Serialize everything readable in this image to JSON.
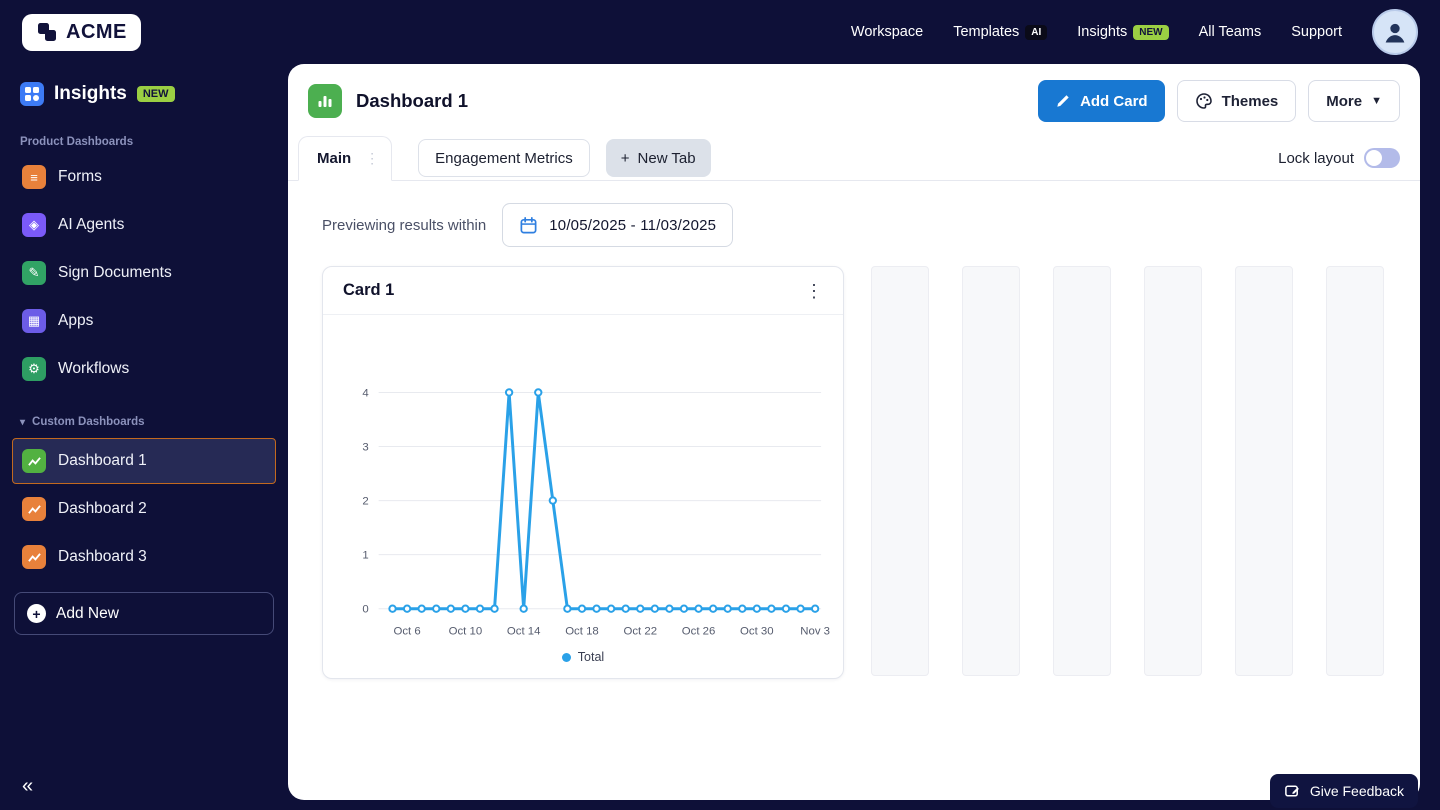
{
  "brand": {
    "name": "ACME"
  },
  "topnav": {
    "items": [
      {
        "label": "Workspace"
      },
      {
        "label": "Templates",
        "badge": "AI"
      },
      {
        "label": "Insights",
        "badge": "NEW"
      },
      {
        "label": "All Teams"
      },
      {
        "label": "Support"
      }
    ]
  },
  "sidebar": {
    "title": "Insights",
    "title_badge": "NEW",
    "products_label": "Product Dashboards",
    "items": [
      {
        "label": "Forms",
        "color": "#E8813B",
        "glyph": "≡"
      },
      {
        "label": "AI Agents",
        "color": "#7A5AF8",
        "glyph": "◈"
      },
      {
        "label": "Sign Documents",
        "color": "#31A365",
        "glyph": "✎"
      },
      {
        "label": "Apps",
        "color": "#6C5CE7",
        "glyph": "▦"
      },
      {
        "label": "Workflows",
        "color": "#2E9E63",
        "glyph": "⚙"
      }
    ],
    "custom_label": "Custom Dashboards",
    "dashboards": [
      {
        "label": "Dashboard 1",
        "color": "#52B141",
        "selected": true
      },
      {
        "label": "Dashboard 2",
        "color": "#E8813B",
        "selected": false
      },
      {
        "label": "Dashboard 3",
        "color": "#E8813B",
        "selected": false
      }
    ],
    "add_new": "Add New",
    "collapse": "«"
  },
  "header": {
    "title": "Dashboard 1",
    "add_card": "Add Card",
    "themes": "Themes",
    "more": "More"
  },
  "tabs": {
    "main": "Main",
    "second": "Engagement Metrics",
    "new_tab": "New Tab",
    "lock_label": "Lock layout"
  },
  "filter": {
    "label": "Previewing results within",
    "range": "10/05/2025 - 11/03/2025"
  },
  "card": {
    "title": "Card 1",
    "menu": "⋮"
  },
  "chart_data": {
    "type": "line",
    "title": "Card 1",
    "x": [
      "Oct 5",
      "Oct 6",
      "Oct 7",
      "Oct 8",
      "Oct 9",
      "Oct 10",
      "Oct 11",
      "Oct 12",
      "Oct 13",
      "Oct 14",
      "Oct 15",
      "Oct 16",
      "Oct 17",
      "Oct 18",
      "Oct 19",
      "Oct 20",
      "Oct 21",
      "Oct 22",
      "Oct 23",
      "Oct 24",
      "Oct 25",
      "Oct 26",
      "Oct 27",
      "Oct 28",
      "Oct 29",
      "Oct 30",
      "Oct 31",
      "Nov 1",
      "Nov 2",
      "Nov 3"
    ],
    "series": [
      {
        "name": "Total",
        "color": "#2AA1E8",
        "values": [
          0,
          0,
          0,
          0,
          0,
          0,
          0,
          0,
          4,
          0,
          4,
          2,
          0,
          0,
          0,
          0,
          0,
          0,
          0,
          0,
          0,
          0,
          0,
          0,
          0,
          0,
          0,
          0,
          0,
          0
        ]
      }
    ],
    "xticks": [
      {
        "index": 1,
        "label": "Oct 6"
      },
      {
        "index": 5,
        "label": "Oct 10"
      },
      {
        "index": 9,
        "label": "Oct 14"
      },
      {
        "index": 13,
        "label": "Oct 18"
      },
      {
        "index": 17,
        "label": "Oct 22"
      },
      {
        "index": 21,
        "label": "Oct 26"
      },
      {
        "index": 25,
        "label": "Oct 30"
      },
      {
        "index": 29,
        "label": "Nov 3"
      }
    ],
    "ylim": [
      0,
      4
    ],
    "yticks": [
      0,
      1,
      2,
      3,
      4
    ],
    "grid": true,
    "legend": {
      "label": "Total",
      "position": "bottom"
    }
  },
  "feedback": {
    "label": "Give Feedback"
  },
  "colors": {
    "navy": "#0E1038",
    "accent_blue": "#1878D2",
    "chart_blue": "#2AA1E8",
    "badge_green": "#9BCF43",
    "selected_border": "#C2691F"
  }
}
